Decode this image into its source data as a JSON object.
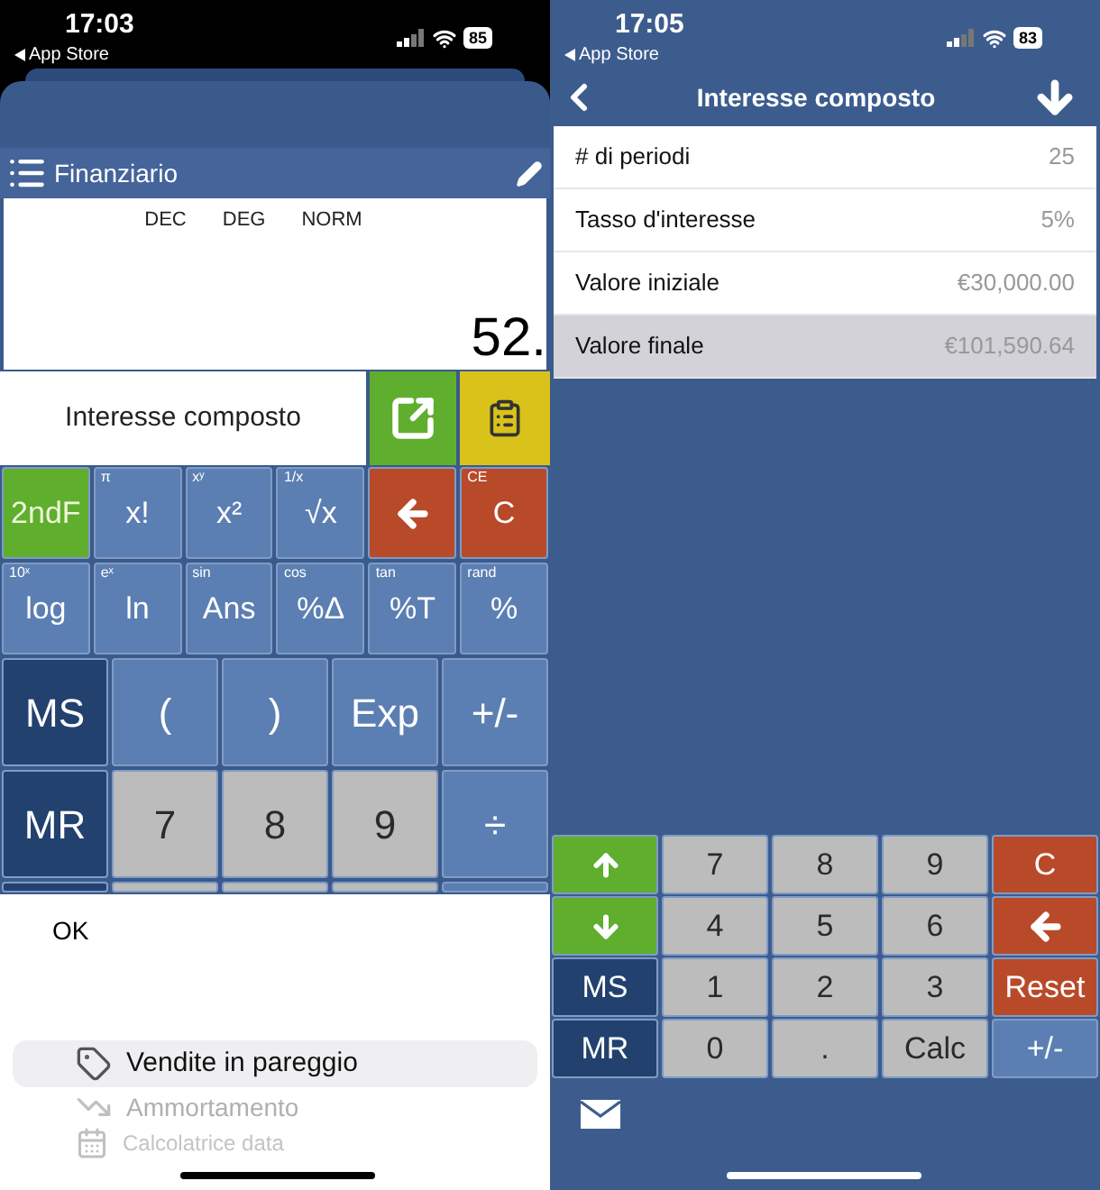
{
  "left_screen": {
    "status_bar": {
      "time": "17:03",
      "back_app": "App Store",
      "battery": "85"
    },
    "toolbar": {
      "title": "Finanziario"
    },
    "display": {
      "indicators": [
        "DEC",
        "DEG",
        "NORM"
      ],
      "value": "52."
    },
    "mode": {
      "label": "Interesse composto"
    },
    "key_rows": [
      [
        {
          "kind": "toggle",
          "label": "2ndF"
        },
        {
          "kind": "function",
          "label": "x!",
          "secondary": "π"
        },
        {
          "kind": "function",
          "label": "x²",
          "secondary": "xʸ"
        },
        {
          "kind": "function",
          "label": "√x",
          "secondary": "1/x"
        },
        {
          "kind": "backspace"
        },
        {
          "kind": "clear",
          "label": "C",
          "secondary": "CE"
        }
      ],
      [
        {
          "kind": "function",
          "label": "log",
          "secondary": "10ˣ"
        },
        {
          "kind": "function",
          "label": "ln",
          "secondary": "eˣ"
        },
        {
          "kind": "function",
          "label": "Ans",
          "secondary": "sin"
        },
        {
          "kind": "function",
          "label": "%Δ",
          "secondary": "cos"
        },
        {
          "kind": "function",
          "label": "%T",
          "secondary": "tan"
        },
        {
          "kind": "function",
          "label": "%",
          "secondary": "rand"
        }
      ],
      [
        {
          "kind": "memory",
          "label": "MS"
        },
        {
          "kind": "function",
          "label": "("
        },
        {
          "kind": "function",
          "label": ")"
        },
        {
          "kind": "function",
          "label": "Exp"
        },
        {
          "kind": "function",
          "label": "+/-"
        }
      ],
      [
        {
          "kind": "memory",
          "label": "MR"
        },
        {
          "kind": "digit",
          "label": "7"
        },
        {
          "kind": "digit",
          "label": "8"
        },
        {
          "kind": "digit",
          "label": "9"
        },
        {
          "kind": "function",
          "label": "÷"
        }
      ],
      [
        {
          "kind": "memory"
        },
        {
          "kind": "digit"
        },
        {
          "kind": "digit"
        },
        {
          "kind": "digit"
        },
        {
          "kind": "function"
        }
      ]
    ],
    "picker": {
      "ok": "OK",
      "items": [
        {
          "kind": "tag",
          "label": "Vendite in pareggio",
          "selected": true
        },
        {
          "kind": "chart",
          "label": "Ammortamento",
          "selected": false
        },
        {
          "kind": "calendar",
          "label": "Calcolatrice data",
          "selected": false
        }
      ]
    }
  },
  "right_screen": {
    "status_bar": {
      "time": "17:05",
      "back_app": "App Store",
      "battery": "83"
    },
    "nav": {
      "title": "Interesse composto"
    },
    "fields": [
      {
        "label": "# di periodi",
        "value": "25",
        "selected": false
      },
      {
        "label": "Tasso d'interesse",
        "value": "5%",
        "selected": false
      },
      {
        "label": "Valore iniziale",
        "value": "€30,000.00",
        "selected": false
      },
      {
        "label": "Valore finale",
        "value": "€101,590.64",
        "selected": true
      }
    ],
    "key_rows": [
      [
        {
          "kind": "up"
        },
        {
          "kind": "digit",
          "label": "7"
        },
        {
          "kind": "digit",
          "label": "8"
        },
        {
          "kind": "digit",
          "label": "9"
        },
        {
          "kind": "clear",
          "label": "C"
        }
      ],
      [
        {
          "kind": "down"
        },
        {
          "kind": "digit",
          "label": "4"
        },
        {
          "kind": "digit",
          "label": "5"
        },
        {
          "kind": "digit",
          "label": "6"
        },
        {
          "kind": "backspace"
        }
      ],
      [
        {
          "kind": "memory",
          "label": "MS"
        },
        {
          "kind": "digit",
          "label": "1"
        },
        {
          "kind": "digit",
          "label": "2"
        },
        {
          "kind": "digit",
          "label": "3"
        },
        {
          "kind": "clear",
          "label": "Reset"
        }
      ],
      [
        {
          "kind": "memory",
          "label": "MR"
        },
        {
          "kind": "digit",
          "label": "0"
        },
        {
          "kind": "digit",
          "label": "."
        },
        {
          "kind": "digit",
          "label": "Calc"
        },
        {
          "kind": "function",
          "label": "+/-"
        }
      ]
    ]
  }
}
